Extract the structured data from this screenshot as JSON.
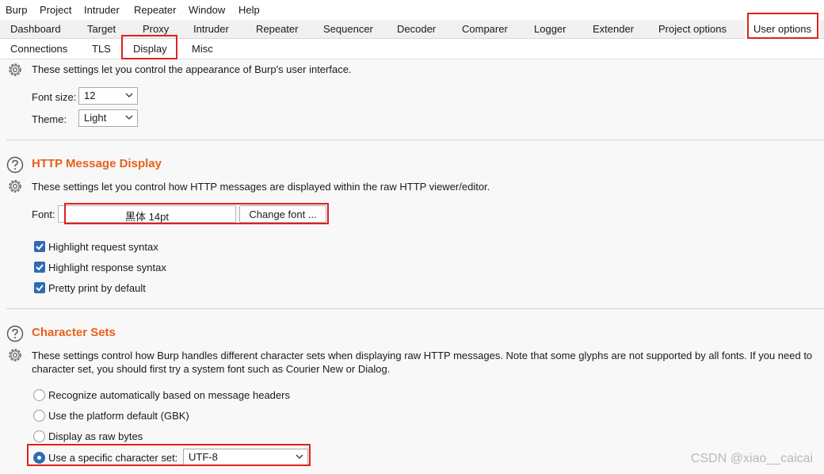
{
  "menubar": {
    "items": [
      "Burp",
      "Project",
      "Intruder",
      "Repeater",
      "Window",
      "Help"
    ]
  },
  "tabs": {
    "items": [
      "Dashboard",
      "Target",
      "Proxy",
      "Intruder",
      "Repeater",
      "Sequencer",
      "Decoder",
      "Comparer",
      "Logger",
      "Extender",
      "Project options",
      "User options"
    ],
    "active": "User options"
  },
  "subtabs": {
    "items": [
      "Connections",
      "TLS",
      "Display",
      "Misc"
    ],
    "active": "Display"
  },
  "ui_section": {
    "description": "These settings let you control the appearance of Burp's user interface.",
    "font_size_label": "Font size:",
    "font_size_value": "12",
    "theme_label": "Theme:",
    "theme_value": "Light"
  },
  "http_section": {
    "title": "HTTP Message Display",
    "description": "These settings let you control how HTTP messages are displayed within the raw HTTP viewer/editor.",
    "font_label": "Font:",
    "font_value": "黑体  14pt",
    "change_font_label": "Change font ...",
    "checkboxes": [
      {
        "label": "Highlight request syntax",
        "checked": true
      },
      {
        "label": "Highlight response syntax",
        "checked": true
      },
      {
        "label": "Pretty print by default",
        "checked": true
      }
    ]
  },
  "charset_section": {
    "title": "Character Sets",
    "description_line1": "These settings control how Burp handles different character sets when displaying raw HTTP messages. Note that some glyphs are not supported by all fonts. If you need to",
    "description_line2": "character set, you should first try a system font such as Courier New or Dialog.",
    "options": [
      {
        "label": "Recognize automatically based on message headers",
        "selected": false
      },
      {
        "label": "Use the platform default (GBK)",
        "selected": false
      },
      {
        "label": "Display as raw bytes",
        "selected": false
      },
      {
        "label": "Use a specific character set:",
        "selected": true
      }
    ],
    "charset_value": "UTF-8"
  },
  "watermark": "CSDN @xiao__caicai",
  "colors": {
    "heading": "#e8601a",
    "highlight_box": "#e02020",
    "checkbox": "#2f6bb3"
  }
}
